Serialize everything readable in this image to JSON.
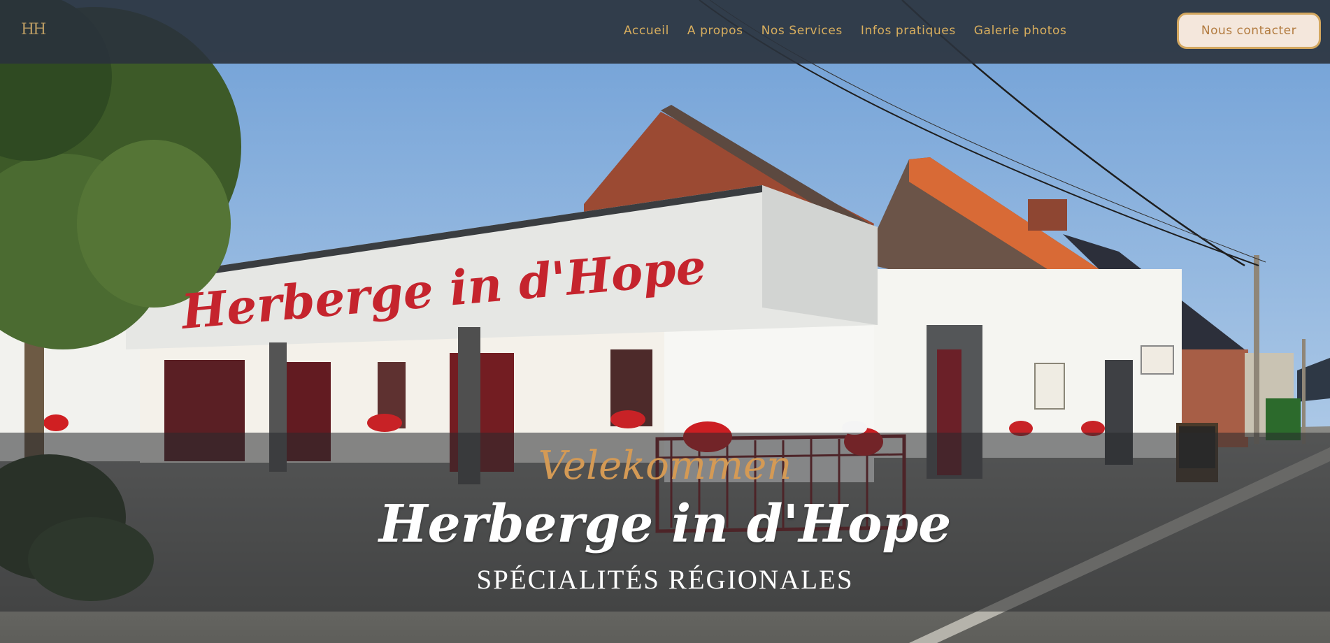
{
  "site": {
    "logo_text": "HH",
    "sign_text": "Herberge in d'Hope"
  },
  "nav": {
    "items": [
      {
        "label": "Accueil"
      },
      {
        "label": "A propos"
      },
      {
        "label": "Nos Services"
      },
      {
        "label": "Infos pratiques"
      },
      {
        "label": "Galerie photos"
      }
    ],
    "cta_label": "Nous contacter"
  },
  "hero": {
    "eyebrow": "Velekommen",
    "title": "Herberge in d'Hope",
    "subtitle": "SPÉCIALITÉS RÉGIONALES"
  },
  "colors": {
    "topbar": "#2a323c",
    "nav_text": "#d8ae5e",
    "cta_border": "#d3a75f",
    "cta_bg": "#f4e7dc",
    "cta_text": "#b27b3f",
    "accent": "#d49a55"
  }
}
